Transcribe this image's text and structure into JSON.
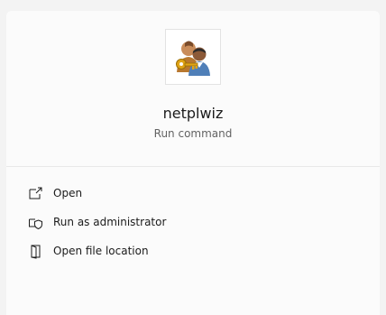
{
  "app": {
    "title": "netplwiz",
    "subtitle": "Run command",
    "icon": "user-accounts-key-icon"
  },
  "actions": [
    {
      "label": "Open",
      "icon": "open-external-icon"
    },
    {
      "label": "Run as administrator",
      "icon": "shield-admin-icon"
    },
    {
      "label": "Open file location",
      "icon": "folder-door-icon"
    }
  ],
  "colors": {
    "background": "#f3f3f3",
    "panel": "#fbfbfb",
    "text": "#1b1b1b",
    "subtext": "#636363"
  }
}
